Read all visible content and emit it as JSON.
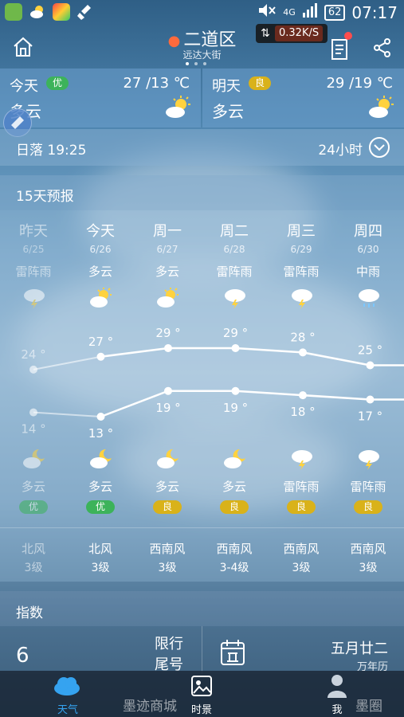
{
  "status": {
    "network": "4G",
    "battery": "62",
    "time": "07:17"
  },
  "header": {
    "city": "二道区",
    "subtitle": "远达大街",
    "speed": "0.32K/S"
  },
  "today": {
    "label": "今天",
    "aq": "优",
    "temp": "27 /13 ℃",
    "cond": "多云"
  },
  "tomorrow": {
    "label": "明天",
    "aq": "良",
    "temp": "29 /19 ℃",
    "cond": "多云"
  },
  "sunset": {
    "text": "日落 19:25",
    "hourly": "24小时"
  },
  "forecast": {
    "title": "15天预报",
    "days": [
      {
        "weekday": "昨天",
        "date": "6/25",
        "day_cond": "雷阵雨",
        "high": "24 °",
        "low": "14 °",
        "night_cond": "多云",
        "aq": "优",
        "wind_dir": "北风",
        "wind_level": "3级",
        "day_icon": "thunder-cloud-icon",
        "night_icon": "moon-cloud-icon"
      },
      {
        "weekday": "今天",
        "date": "6/26",
        "day_cond": "多云",
        "high": "27 °",
        "low": "13 °",
        "night_cond": "多云",
        "aq": "优",
        "wind_dir": "北风",
        "wind_level": "3级",
        "day_icon": "sun-cloud-icon",
        "night_icon": "moon-cloud-icon"
      },
      {
        "weekday": "周一",
        "date": "6/27",
        "day_cond": "多云",
        "high": "29 °",
        "low": "19 °",
        "night_cond": "多云",
        "aq": "良",
        "wind_dir": "西南风",
        "wind_level": "3级",
        "day_icon": "sun-cloud-icon",
        "night_icon": "moon-cloud-icon"
      },
      {
        "weekday": "周二",
        "date": "6/28",
        "day_cond": "雷阵雨",
        "high": "29 °",
        "low": "19 °",
        "night_cond": "多云",
        "aq": "良",
        "wind_dir": "西南风",
        "wind_level": "3-4级",
        "day_icon": "thunder-cloud-icon",
        "night_icon": "moon-cloud-icon"
      },
      {
        "weekday": "周三",
        "date": "6/29",
        "day_cond": "雷阵雨",
        "high": "28 °",
        "low": "18 °",
        "night_cond": "雷阵雨",
        "aq": "良",
        "wind_dir": "西南风",
        "wind_level": "3级",
        "day_icon": "thunder-cloud-icon",
        "night_icon": "thunder-cloud-icon"
      },
      {
        "weekday": "周四",
        "date": "6/30",
        "day_cond": "中雨",
        "high": "25 °",
        "low": "17 °",
        "night_cond": "雷阵雨",
        "aq": "良",
        "wind_dir": "西南风",
        "wind_level": "3级",
        "day_icon": "rain-cloud-icon",
        "night_icon": "thunder-cloud-icon"
      }
    ],
    "highs": [
      24,
      27,
      29,
      29,
      28,
      25
    ],
    "lows": [
      14,
      13,
      19,
      19,
      18,
      17
    ]
  },
  "index": {
    "title": "指数",
    "value": "6",
    "restriction": [
      "限行",
      "尾号"
    ],
    "lunar_date": "五月廿二",
    "calendar_name": "万年历"
  },
  "nav": {
    "weather": "天气",
    "time_view": "时景",
    "me": "我",
    "promo_left": "墨迹商城",
    "promo_right": "墨圈"
  },
  "colors": {
    "aq_good": "#3cb35a",
    "aq_fair": "#d9b21a"
  }
}
